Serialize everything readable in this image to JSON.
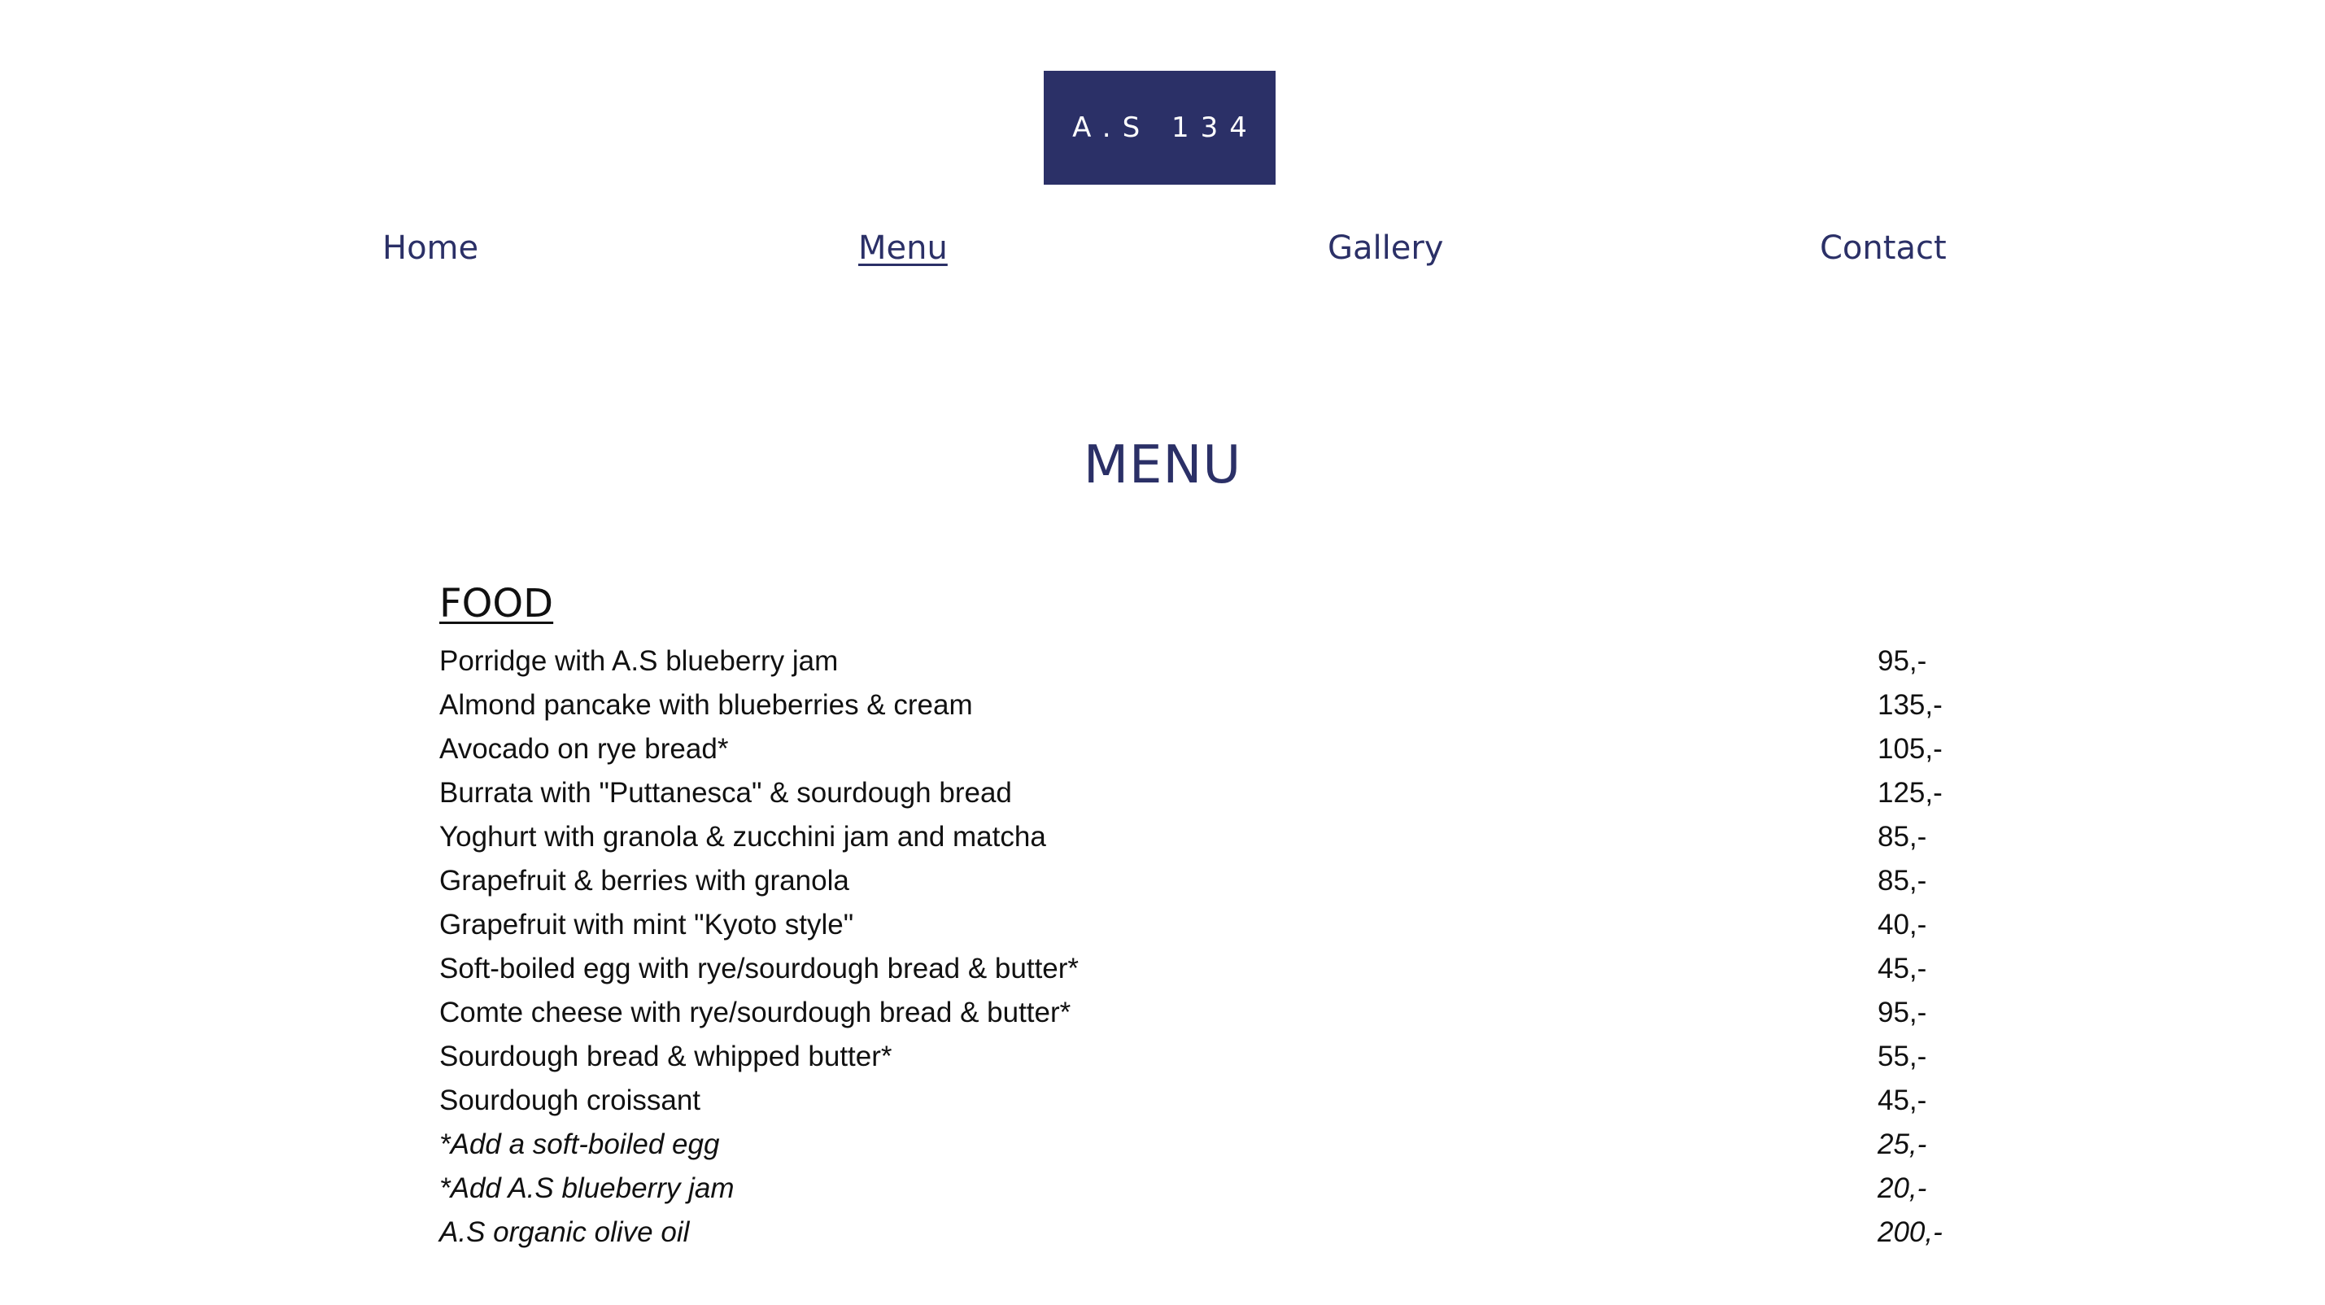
{
  "logo": {
    "text": "A.S 134"
  },
  "nav": [
    {
      "label": "Home",
      "active": false
    },
    {
      "label": "Menu",
      "active": true
    },
    {
      "label": "Gallery",
      "active": false
    },
    {
      "label": "Contact",
      "active": false
    }
  ],
  "page_title": "MENU",
  "section": {
    "title": "FOOD",
    "items": [
      {
        "name": "Porridge with A.S blueberry jam",
        "price": "95,-"
      },
      {
        "name": "Almond pancake with blueberries & cream",
        "price": "135,-"
      },
      {
        "name": "Avocado on rye bread*",
        "price": "105,-"
      },
      {
        "name": "Burrata with \"Puttanesca\" & sourdough bread",
        "price": "125,-"
      },
      {
        "name": "Yoghurt with granola & zucchini jam and matcha",
        "price": "85,-"
      },
      {
        "name": "Grapefruit & berries with granola",
        "price": "85,-"
      },
      {
        "name": "Grapefruit with mint \"Kyoto style\"",
        "price": "40,-"
      },
      {
        "name": "Soft-boiled egg with rye/sourdough bread & butter*",
        "price": "45,-"
      },
      {
        "name": "Comte cheese with rye/sourdough bread & butter*",
        "price": "95,-"
      },
      {
        "name": "Sourdough bread & whipped butter*",
        "price": "55,-"
      },
      {
        "name": "Sourdough croissant",
        "price": "45,-"
      },
      {
        "name": "*Add a soft-boiled egg",
        "price": "25,-"
      },
      {
        "name": "*Add A.S blueberry jam",
        "price": "20,-"
      },
      {
        "name": "A.S organic olive oil",
        "price": "200,-"
      }
    ]
  },
  "colors": {
    "brand": "#2b3067",
    "text": "#111111",
    "background": "#ffffff"
  }
}
